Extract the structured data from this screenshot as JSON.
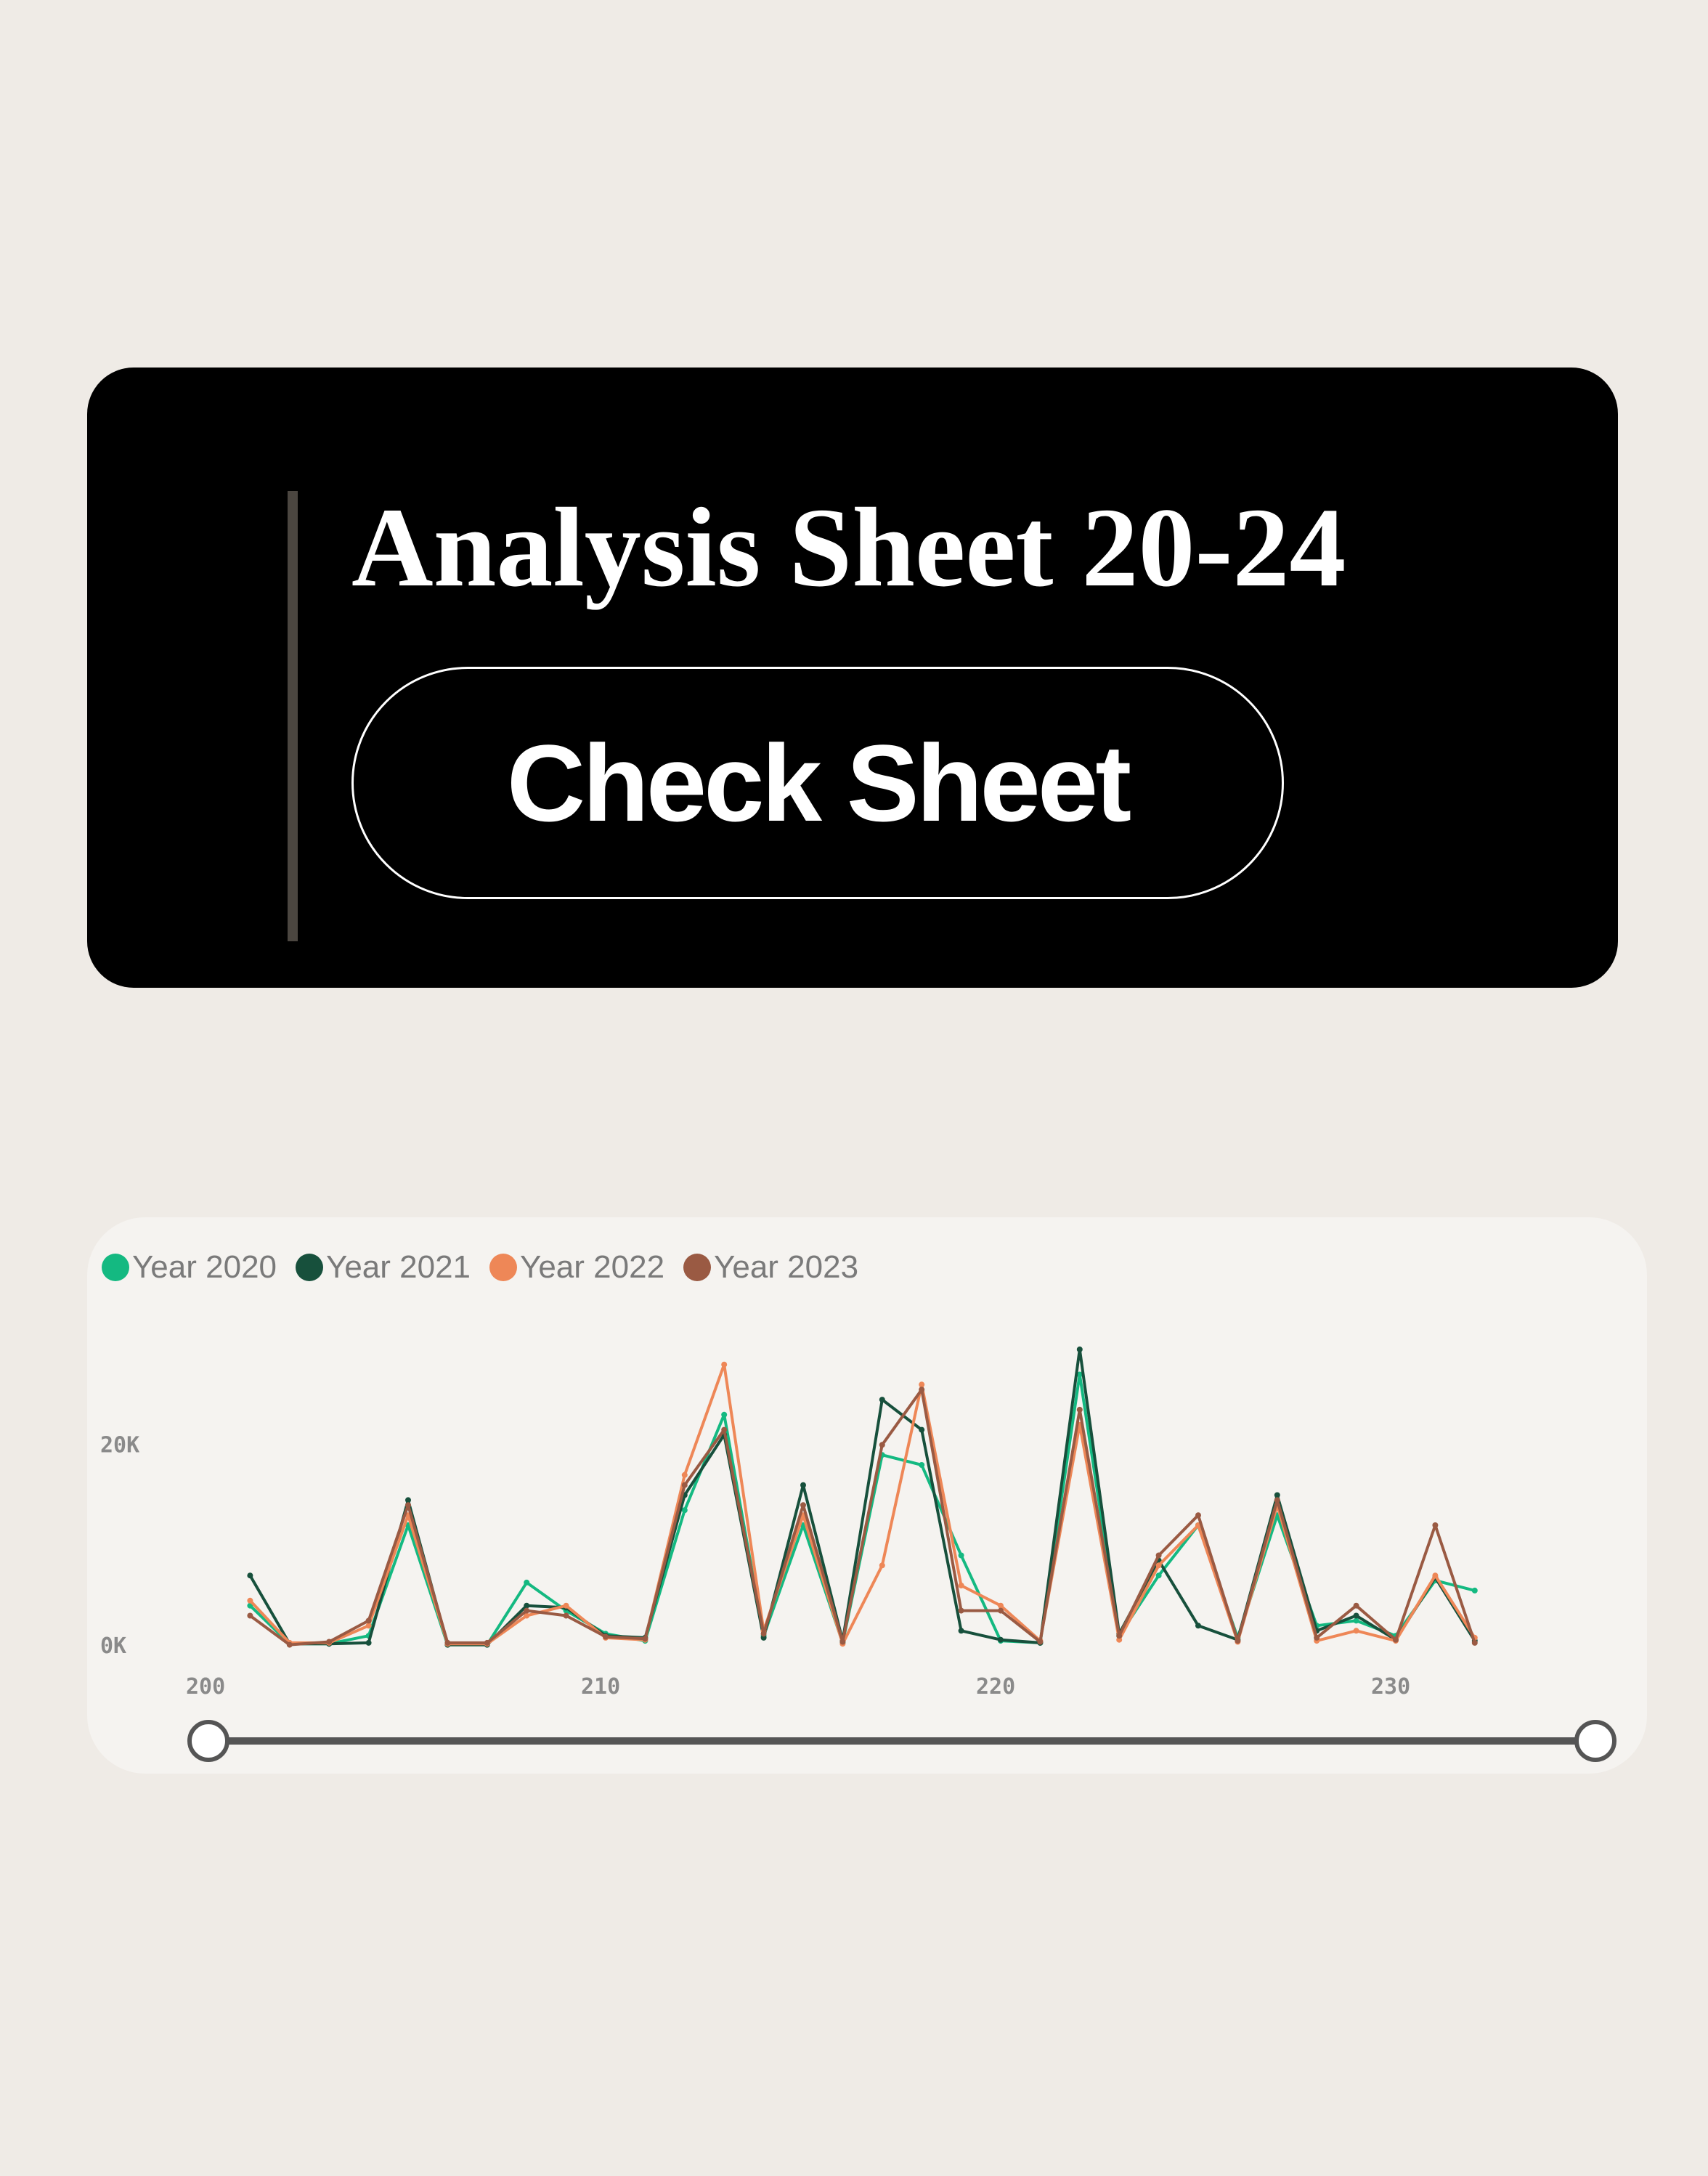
{
  "header": {
    "title": "Analysis Sheet 20-24",
    "button_label": "Check Sheet"
  },
  "colors": {
    "background": "#efebe6",
    "card": "#000000",
    "chart_card": "#f5f3f0"
  },
  "chart_data": {
    "type": "line",
    "x": [
      201,
      202,
      203,
      204,
      205,
      206,
      207,
      208,
      209,
      210,
      211,
      212,
      213,
      214,
      215,
      216,
      217,
      218,
      219,
      220,
      221,
      222,
      223,
      224,
      225,
      226,
      227,
      228,
      229,
      230,
      231,
      232
    ],
    "series": [
      {
        "name": "Year 2020",
        "color": "#14b981",
        "values": [
          4000,
          200,
          200,
          1000,
          12000,
          100,
          100,
          6300,
          3500,
          1200,
          500,
          13500,
          23000,
          1000,
          12000,
          300,
          19000,
          18000,
          9000,
          500,
          300,
          27000,
          1000,
          7000,
          12000,
          800,
          13000,
          2000,
          2500,
          1000,
          6500,
          5500
        ]
      },
      {
        "name": "Year 2021",
        "color": "#17503c",
        "values": [
          7000,
          200,
          200,
          300,
          14500,
          100,
          100,
          4000,
          3800,
          1000,
          800,
          15000,
          21000,
          800,
          16000,
          500,
          24500,
          21500,
          1500,
          600,
          300,
          29500,
          1200,
          8500,
          2000,
          600,
          15000,
          1500,
          3000,
          600,
          6800,
          500
        ]
      },
      {
        "name": "Year 2022",
        "color": "#ee8757",
        "values": [
          4500,
          300,
          300,
          2000,
          13000,
          200,
          200,
          3000,
          4000,
          800,
          600,
          17000,
          28000,
          1500,
          13000,
          200,
          8000,
          26000,
          6000,
          4000,
          500,
          22000,
          600,
          8000,
          12000,
          400,
          14000,
          500,
          1500,
          500,
          7000,
          800
        ]
      },
      {
        "name": "Year 2023",
        "color": "#9a5a43",
        "values": [
          3000,
          100,
          400,
          2500,
          14000,
          300,
          300,
          3500,
          3000,
          900,
          700,
          16000,
          21500,
          1200,
          14000,
          400,
          20000,
          25500,
          3500,
          3500,
          400,
          23500,
          1000,
          9000,
          13000,
          500,
          14500,
          800,
          4000,
          600,
          12000,
          300
        ]
      }
    ],
    "x_ticks": [
      "200",
      "210",
      "220",
      "230"
    ],
    "y_ticks": [
      "0K",
      "20K"
    ],
    "xlim": [
      200,
      235
    ],
    "ylim": [
      0,
      30000
    ],
    "grid": false,
    "legend": "top-left"
  }
}
